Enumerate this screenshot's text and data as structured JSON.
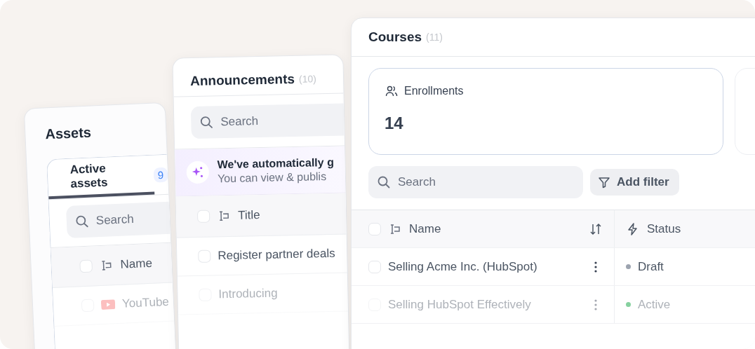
{
  "assets": {
    "title": "Assets",
    "tabs": [
      {
        "label": "Active assets",
        "badge": "9",
        "selected": true
      }
    ],
    "search": {
      "placeholder": "Search"
    },
    "columns": [
      {
        "label": "Name"
      }
    ],
    "rows": [
      {
        "name": "YouTube",
        "checked": false
      }
    ],
    "all_checked": false
  },
  "announcements": {
    "title": "Announcements",
    "count": "(10)",
    "search": {
      "placeholder": "Search"
    },
    "banner": {
      "title": "We've automatically g",
      "text": "You can view & publis"
    },
    "columns": [
      {
        "label": "Title"
      }
    ],
    "rows": [
      {
        "title": "Register partner deals",
        "checked": false
      },
      {
        "title": "Introducing",
        "checked": false
      }
    ],
    "all_checked": false
  },
  "courses": {
    "title": "Courses",
    "count": "(11)",
    "stats": [
      {
        "label": "Enrollments",
        "value": "14"
      }
    ],
    "search": {
      "placeholder": "Search"
    },
    "filter_button": "Add filter",
    "columns": [
      {
        "label": "Name"
      },
      {
        "label": "Status"
      }
    ],
    "rows": [
      {
        "name": "Selling Acme Inc. (HubSpot)",
        "status": "Draft",
        "color": "#9ca3af",
        "checked": false
      },
      {
        "name": "Selling HubSpot Effectively",
        "status": "Active",
        "color": "#86d19f",
        "checked": false
      }
    ],
    "all_checked": false
  }
}
